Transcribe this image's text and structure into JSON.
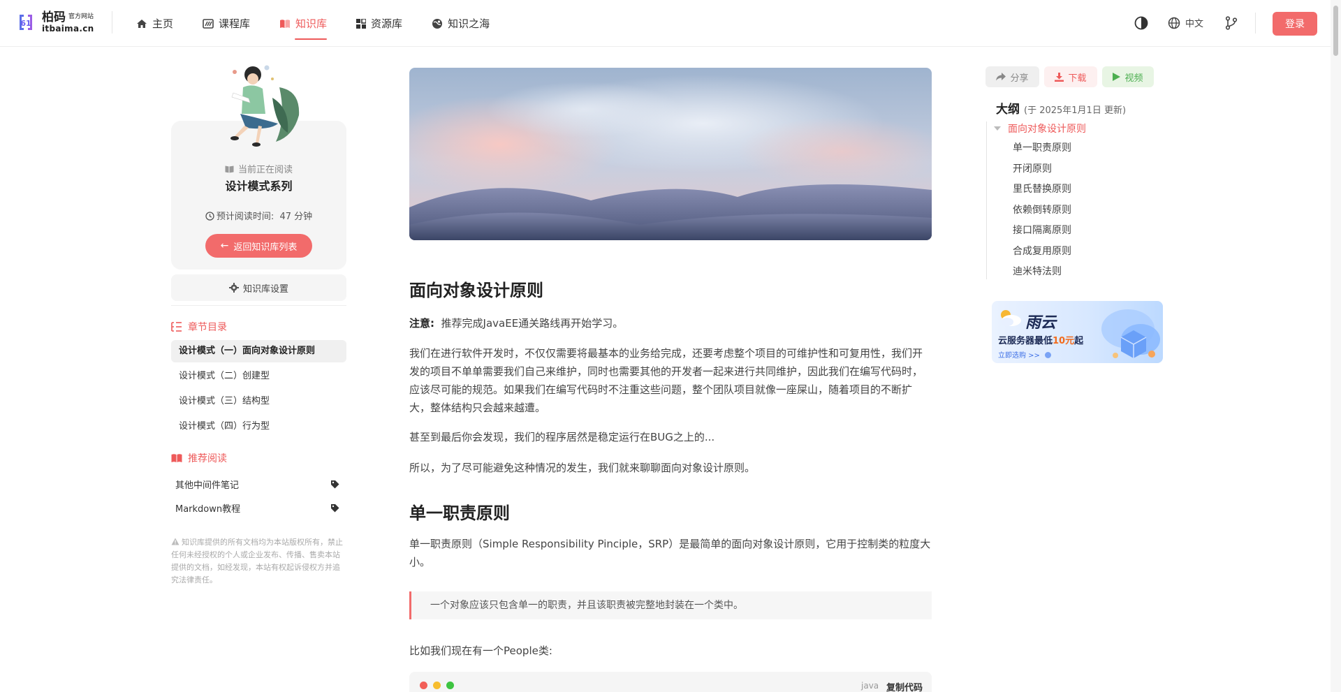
{
  "header": {
    "logo": {
      "name": "柏码",
      "tag": "官方网站",
      "domain": "itbaima.cn"
    },
    "nav": [
      {
        "label": "主页",
        "icon": "home-icon"
      },
      {
        "label": "课程库",
        "icon": "course-icon"
      },
      {
        "label": "知识库",
        "icon": "book-icon",
        "active": true
      },
      {
        "label": "资源库",
        "icon": "grid-icon"
      },
      {
        "label": "知识之海",
        "icon": "globe-sea-icon"
      }
    ],
    "language": "中文",
    "login": "登录"
  },
  "sidebar": {
    "reading_label": "当前正在阅读",
    "reading_title": "设计模式系列",
    "reading_time_label": "预计阅读时间:",
    "reading_time_value": "47 分钟",
    "back_button": "返回知识库列表",
    "settings_button": "知识库设置",
    "chapters_title": "章节目录",
    "chapters": [
      {
        "label": "设计模式（一）面向对象设计原则",
        "active": true
      },
      {
        "label": "设计模式（二）创建型"
      },
      {
        "label": "设计模式（三）结构型"
      },
      {
        "label": "设计模式（四）行为型"
      }
    ],
    "recommend_title": "推荐阅读",
    "recommend": [
      {
        "label": "其他中间件笔记"
      },
      {
        "label": "Markdown教程"
      }
    ],
    "note": "知识库提供的所有文档均为本站版权所有，禁止任何未经授权的个人或企业发布、传播、售卖本站提供的文档，如经发现，本站有权起诉侵权方并追究法律责任。"
  },
  "article": {
    "h1": "面向对象设计原则",
    "notice_label": "注意:",
    "notice_text": "推荐完成JavaEE通关路线再开始学习。",
    "p1": "我们在进行软件开发时，不仅仅需要将最基本的业务给完成，还要考虑整个项目的可维护性和可复用性，我们开发的项目不单单需要我们自己来维护，同时也需要其他的开发者一起来进行共同维护，因此我们在编写代码时，应该尽可能的规范。如果我们在编写代码时不注重这些问题，整个团队项目就像一座屎山，随着项目的不断扩大，整体结构只会越来越遭。",
    "p2": "甚至到最后你会发现，我们的程序居然是稳定运行在BUG之上的...",
    "p3": "所以，为了尽可能避免这种情况的发生，我们就来聊聊面向对象设计原则。",
    "h2": "单一职责原则",
    "p4": "单一职责原则（Simple Responsibility Pinciple，SRP）是最简单的面向对象设计原则，它用于控制类的粒度大小。",
    "quote": "一个对象应该只包含单一的职责，并且该职责被完整地封装在一个类中。",
    "p5": "比如我们现在有一个People类:",
    "code_lang": "java",
    "code_copy": "复制代码"
  },
  "right": {
    "share": "分享",
    "download": "下载",
    "video": "视频",
    "outline_title": "大纲",
    "outline_updated": "(于 2025年1月1日 更新)",
    "outline_root": "面向对象设计原则",
    "outline_items": [
      "单一职责原则",
      "开闭原则",
      "里氏替换原则",
      "依赖倒转原则",
      "接口隔离原则",
      "合成复用原则",
      "迪米特法则"
    ],
    "ad": {
      "title": "雨云",
      "sub_prefix": "云服务器最低",
      "sub_highlight": "10元",
      "sub_suffix": "起",
      "link": "立即选购 >>"
    }
  },
  "colors": {
    "accent": "#ee5a5a",
    "button": "#f26b6b",
    "video_green": "#4caf50"
  }
}
